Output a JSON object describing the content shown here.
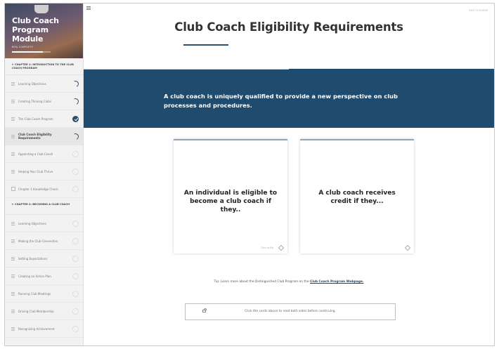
{
  "sidebar": {
    "title": "Club Coach Program Module",
    "progress_label": "80% COMPLETE",
    "progress_fraction": 0.8,
    "chapters": [
      {
        "label": "CHAPTER 1: INTRODUCTION TO THE CLUB COACH PROGRAM",
        "lessons": [
          {
            "label": "Learning Objectives",
            "status": "partial"
          },
          {
            "label": "Creating Thriving Clubs",
            "status": "partial"
          },
          {
            "label": "The Club Coach Program",
            "status": "done"
          },
          {
            "label": "Club Coach Eligibility Requirements",
            "status": "partial"
          },
          {
            "label": "Appointing a Club Coach",
            "status": "none"
          },
          {
            "label": "Helping Your Club Thrive",
            "status": "none"
          },
          {
            "label": "Chapter 1 Knowledge Check",
            "status": "none"
          }
        ]
      },
      {
        "label": "CHAPTER 2: BECOMING A CLUB COACH",
        "lessons": [
          {
            "label": "Learning Objectives",
            "status": "none"
          },
          {
            "label": "Making the Club Connection",
            "status": "none"
          },
          {
            "label": "Setting Expectations",
            "status": "none"
          },
          {
            "label": "Creating an Action Plan",
            "status": "none"
          },
          {
            "label": "Running Club Meetings",
            "status": "none"
          },
          {
            "label": "Driving Club Membership",
            "status": "none"
          },
          {
            "label": "Recognizing Achievement",
            "status": "none"
          }
        ]
      }
    ]
  },
  "header": {
    "exit_label": "EXIT COURSE",
    "page_title": "Club Coach Eligibility Requirements"
  },
  "banner": {
    "text": "A club coach is uniquely qualified to provide a new perspective on club processes and procedures."
  },
  "cards": [
    {
      "text": "An individual is eligible to become a club coach if they..",
      "hint": "Click to flip"
    },
    {
      "text": "A club coach receives credit if they...",
      "hint": ""
    }
  ],
  "tip": {
    "prefix": "Tip: Learn more about the Distinguished Club Program on the ",
    "link": "Club Coach Program Webpage."
  },
  "continue": {
    "label": "Click the cards above to read both sides before continuing."
  },
  "colors": {
    "brand_navy": "#1e4b6e",
    "check_blue": "#2d4f6c"
  }
}
